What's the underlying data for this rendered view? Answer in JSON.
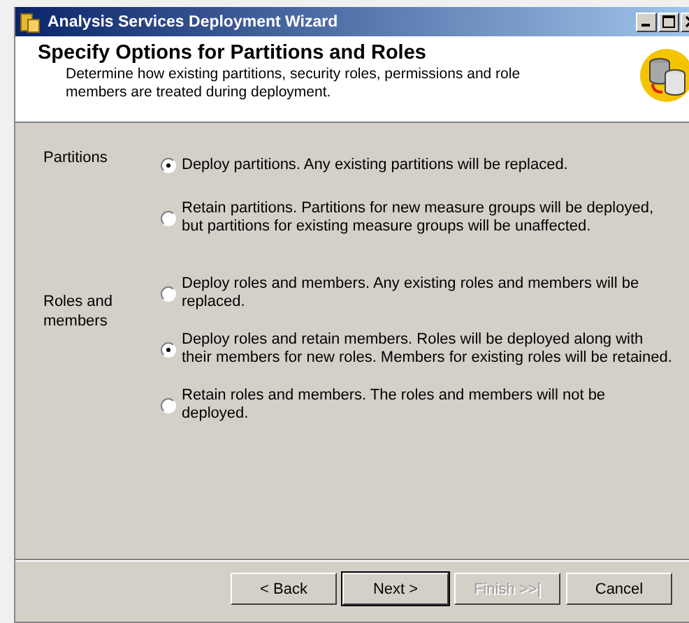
{
  "window": {
    "title": "Analysis Services Deployment Wizard"
  },
  "header": {
    "title": "Specify Options for Partitions and Roles",
    "description": "Determine how existing partitions, security roles, permissions and role members are treated during deployment."
  },
  "groups": [
    {
      "label": "Partitions",
      "options": [
        {
          "text": "Deploy partitions. Any existing partitions will be replaced.",
          "selected": true
        },
        {
          "text": "Retain partitions. Partitions for new measure groups will be deployed, but partitions for existing measure groups will be unaffected.",
          "selected": false
        }
      ]
    },
    {
      "label": "Roles and members",
      "options": [
        {
          "text": "Deploy roles and members. Any existing roles and members will be replaced.",
          "selected": false
        },
        {
          "text": "Deploy roles and retain members. Roles will be deployed along with their members for new roles. Members for existing roles will be retained.",
          "selected": true
        },
        {
          "text": "Retain roles and members. The roles and members will not be deployed.",
          "selected": false
        }
      ]
    }
  ],
  "buttons": [
    {
      "label": "< Back",
      "disabled": false,
      "default": false
    },
    {
      "label": "Next >",
      "disabled": false,
      "default": true
    },
    {
      "label": "Finish >>|",
      "disabled": true,
      "default": false
    },
    {
      "label": "Cancel",
      "disabled": false,
      "default": false
    }
  ]
}
